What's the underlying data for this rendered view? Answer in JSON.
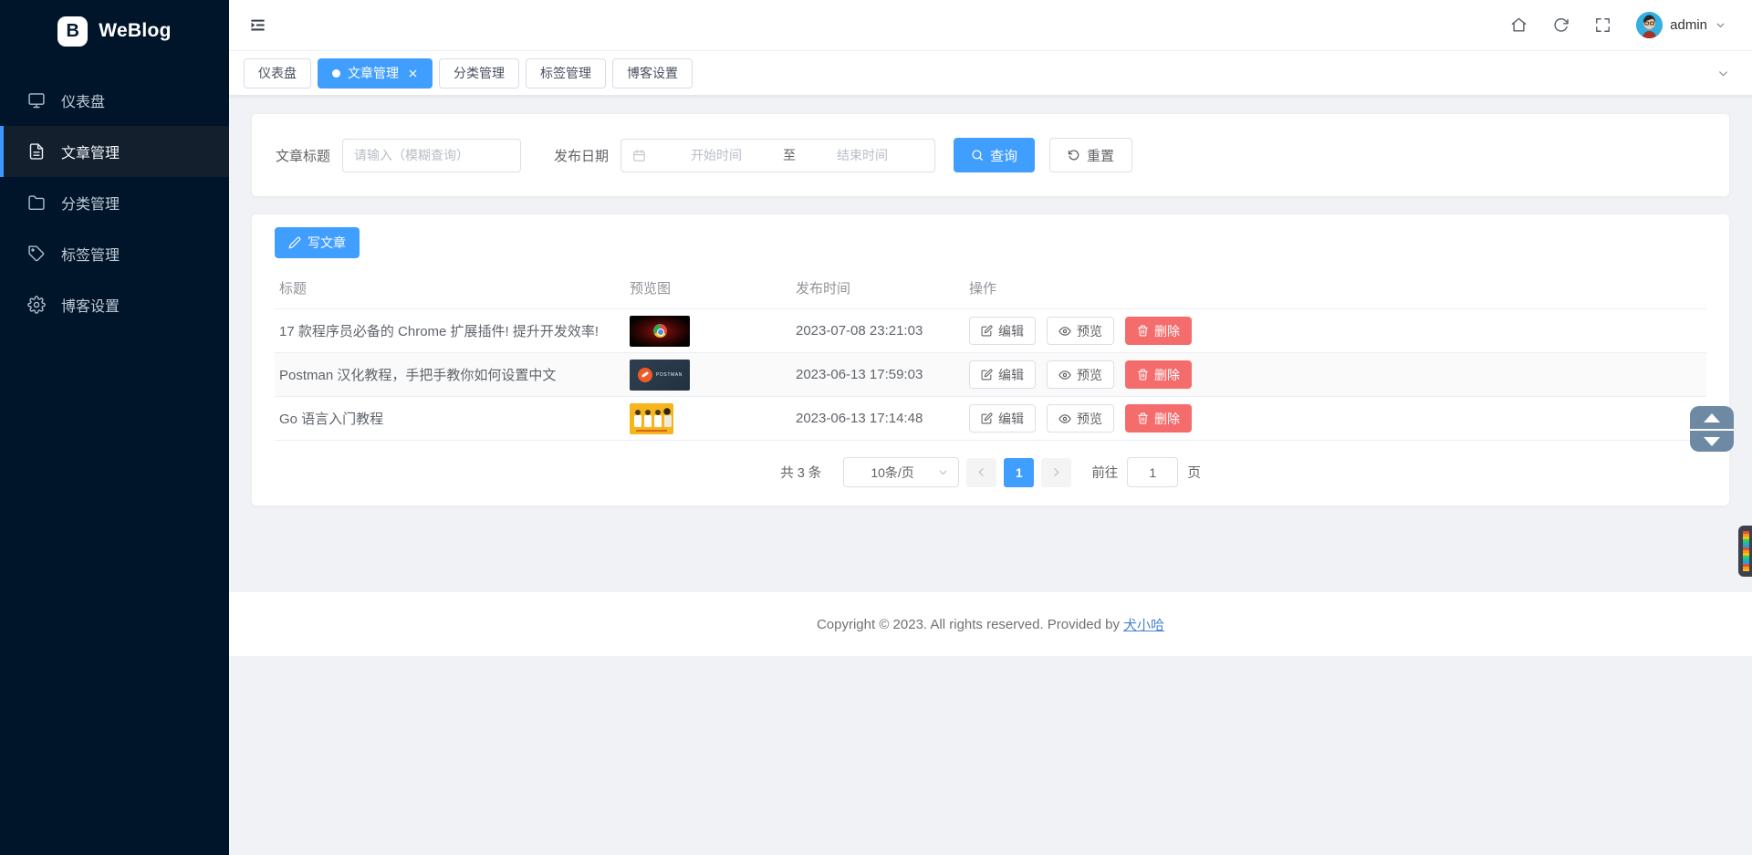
{
  "brand": {
    "name": "WeBlog",
    "logo_letter": "B"
  },
  "sidebar": {
    "items": [
      {
        "label": "仪表盘"
      },
      {
        "label": "文章管理"
      },
      {
        "label": "分类管理"
      },
      {
        "label": "标签管理"
      },
      {
        "label": "博客设置"
      }
    ]
  },
  "header": {
    "user": {
      "name": "admin"
    }
  },
  "tabbar": {
    "tabs": [
      {
        "label": "仪表盘"
      },
      {
        "label": "文章管理"
      },
      {
        "label": "分类管理"
      },
      {
        "label": "标签管理"
      },
      {
        "label": "博客设置"
      }
    ]
  },
  "filter": {
    "title_label": "文章标题",
    "title_placeholder": "请输入（模糊查询）",
    "date_label": "发布日期",
    "date_start_placeholder": "开始时间",
    "date_separator": "至",
    "date_end_placeholder": "结束时间",
    "search_label": "查询",
    "reset_label": "重置"
  },
  "toolbar": {
    "write_label": "写文章"
  },
  "table": {
    "columns": [
      "标题",
      "预览图",
      "发布时间",
      "操作"
    ],
    "action_labels": {
      "edit": "编辑",
      "preview": "预览",
      "delete": "删除"
    },
    "rows": [
      {
        "title": "17 款程序员必备的 Chrome 扩展插件! 提升开发效率!",
        "published": "2023-07-08 23:21:03"
      },
      {
        "title": "Postman 汉化教程，手把手教你如何设置中文",
        "published": "2023-06-13 17:59:03",
        "thumb_text": "POSTMAN"
      },
      {
        "title": "Go 语言入门教程",
        "published": "2023-06-13 17:14:48"
      }
    ]
  },
  "pagination": {
    "total_label": "共 3 条",
    "page_size_label": "10条/页",
    "current_page": "1",
    "goto_label": "前往",
    "goto_value": "1",
    "page_unit": "页"
  },
  "footer": {
    "copyright": "Copyright © 2023. All rights reserved. Provided by",
    "provider_link": "犬小哈"
  },
  "colors": {
    "accent": "#409eff",
    "danger": "#f56c6c",
    "sidebar_bg": "#001529"
  }
}
